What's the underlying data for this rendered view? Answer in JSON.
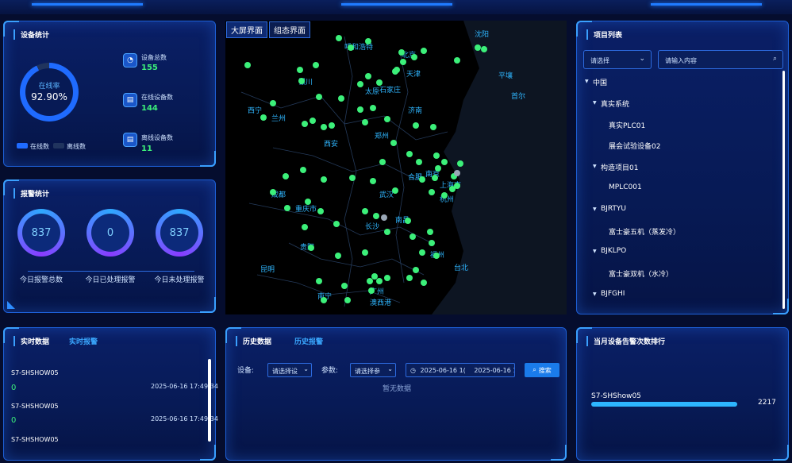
{
  "device_stats": {
    "title": "设备统计",
    "ring_label": "在线率",
    "ring_value": "92.90%",
    "online_fraction": 0.929,
    "legend_online": "在线数",
    "legend_offline": "离线数",
    "total_label": "设备总数",
    "total_value": "155",
    "online_label": "在线设备数",
    "online_value": "144",
    "offline_label": "离线设备数",
    "offline_value": "11"
  },
  "alarm_stats": {
    "title": "报警统计",
    "items": [
      {
        "value": "837",
        "label": "今日报警总数"
      },
      {
        "value": "0",
        "label": "今日已处理报警"
      },
      {
        "value": "837",
        "label": "今日未处理报警"
      }
    ]
  },
  "map": {
    "tab_bigscreen": "大屏界面",
    "tab_config": "组态界面",
    "cities": [
      "沈阳",
      "呼和浩特",
      "北京",
      "天津",
      "银川",
      "太原",
      "石家庄",
      "平壤",
      "西宁",
      "兰州",
      "济南",
      "首尔",
      "郑州",
      "西安",
      "南京",
      "合肥",
      "上海市",
      "武汉",
      "成都",
      "杭州",
      "重庆市",
      "长沙",
      "南昌",
      "贵阳",
      "福州",
      "台北",
      "昆明",
      "广州",
      "南宁",
      "澳西港"
    ]
  },
  "project_list": {
    "title": "项目列表",
    "select_placeholder": "请选择",
    "search_placeholder": "请输入内容",
    "tree": [
      {
        "level": 0,
        "label": "中国",
        "expanded": true
      },
      {
        "level": 1,
        "label": "真实系统",
        "expanded": true
      },
      {
        "level": 2,
        "label": "真实PLC01"
      },
      {
        "level": 2,
        "label": "展会试验设备02"
      },
      {
        "level": 1,
        "label": "构造项目01",
        "expanded": true
      },
      {
        "level": 2,
        "label": "MPLC001"
      },
      {
        "level": 1,
        "label": "BJRTYU",
        "expanded": true
      },
      {
        "level": 2,
        "label": "富士豪五机（蒸发冷）"
      },
      {
        "level": 1,
        "label": "BJKLPO",
        "expanded": true
      },
      {
        "level": 2,
        "label": "富士豪双机（水冷）"
      },
      {
        "level": 1,
        "label": "BJFGHI",
        "expanded": true
      }
    ]
  },
  "realtime": {
    "tab_data": "实时数据",
    "tab_alarm": "实时报警",
    "rows": [
      {
        "name": "S7-SHSHOW05",
        "value": "0",
        "time": "2025-06-16 17:49:34"
      },
      {
        "name": "S7-SHSHOW05",
        "value": "0",
        "time": "2025-06-16 17:49:34"
      },
      {
        "name": "S7-SHSHOW05",
        "value": "",
        "time": ""
      }
    ]
  },
  "history": {
    "tab_data": "历史数据",
    "tab_alarm": "历史报警",
    "device_label": "设备:",
    "device_placeholder": "请选择设",
    "param_label": "参数:",
    "param_placeholder": "请选择参",
    "date_start": "2025-06-16 1(",
    "date_end": "2025-06-16 1(",
    "search_label": "搜索",
    "no_data": "暂无数据"
  },
  "ranking": {
    "title": "当月设备告警次数排行",
    "items": [
      {
        "name": "S7-SHShow05",
        "value": "2217",
        "fraction": 1.0
      }
    ]
  },
  "colors": {
    "accent": "#1f7bff",
    "green": "#3cf07a",
    "panel_bg": "#071a55"
  }
}
